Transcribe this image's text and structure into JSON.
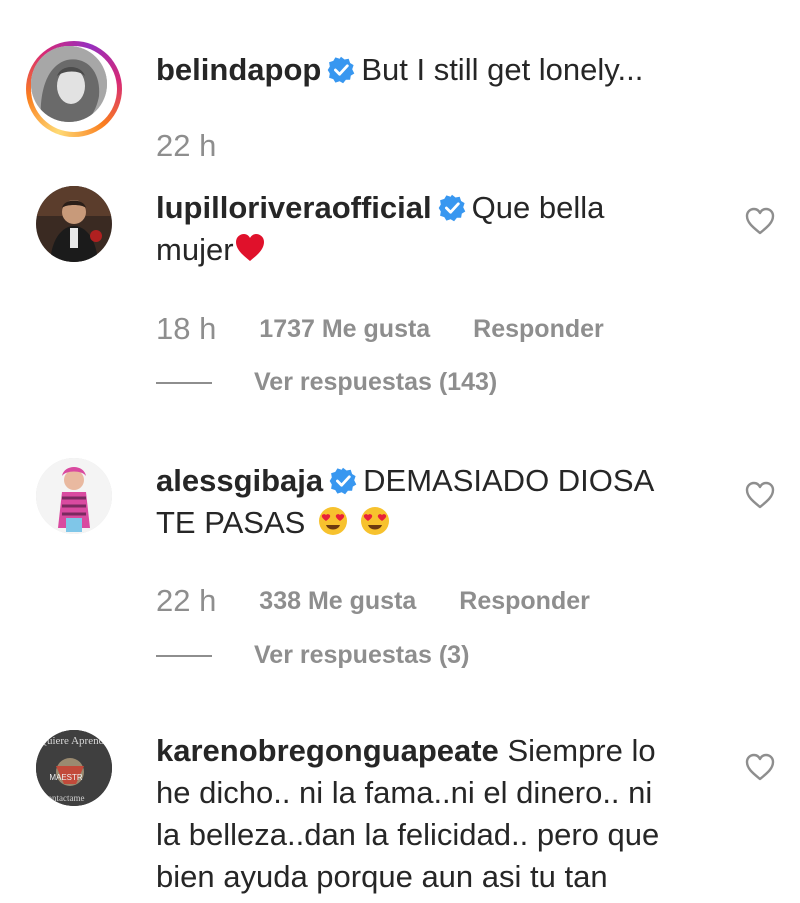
{
  "comments": [
    {
      "username": "belindapop",
      "text": "But I still get lonely...",
      "time": "22 h"
    },
    {
      "username": "lupilloriveraofficial",
      "text_line1": "Que bella",
      "text_line2": "mujer",
      "emoji": "red-heart-emoji",
      "time": "18 h",
      "likes": "1737 Me gusta",
      "reply": "Responder",
      "view_replies": "Ver respuestas (143)"
    },
    {
      "username": "alessgibaja",
      "text_line1": "DEMASIADO DIOSA",
      "text_line2": "TE PASAS",
      "emoji": "heart-eyes-emoji",
      "time": "22 h",
      "likes": "338 Me gusta",
      "reply": "Responder",
      "view_replies": "Ver respuestas (3)"
    },
    {
      "username": "karenobregonguapeate",
      "text_line1": "Siempre lo",
      "text_line2": "he dicho.. ni la fama..ni el dinero.. ni",
      "text_line3": "la belleza..dan la felicidad.. pero que",
      "text_line4": "bien ayuda porque aun asi tu tan",
      "avatar_text_top": "Quiere Aprende",
      "avatar_text_mid": "MAESTR",
      "avatar_text_bot": "ontactame"
    }
  ],
  "colors": {
    "text": "#262626",
    "muted": "#8e8e8e",
    "verified": "#3897f0",
    "like_outline": "#8e8e8e"
  }
}
